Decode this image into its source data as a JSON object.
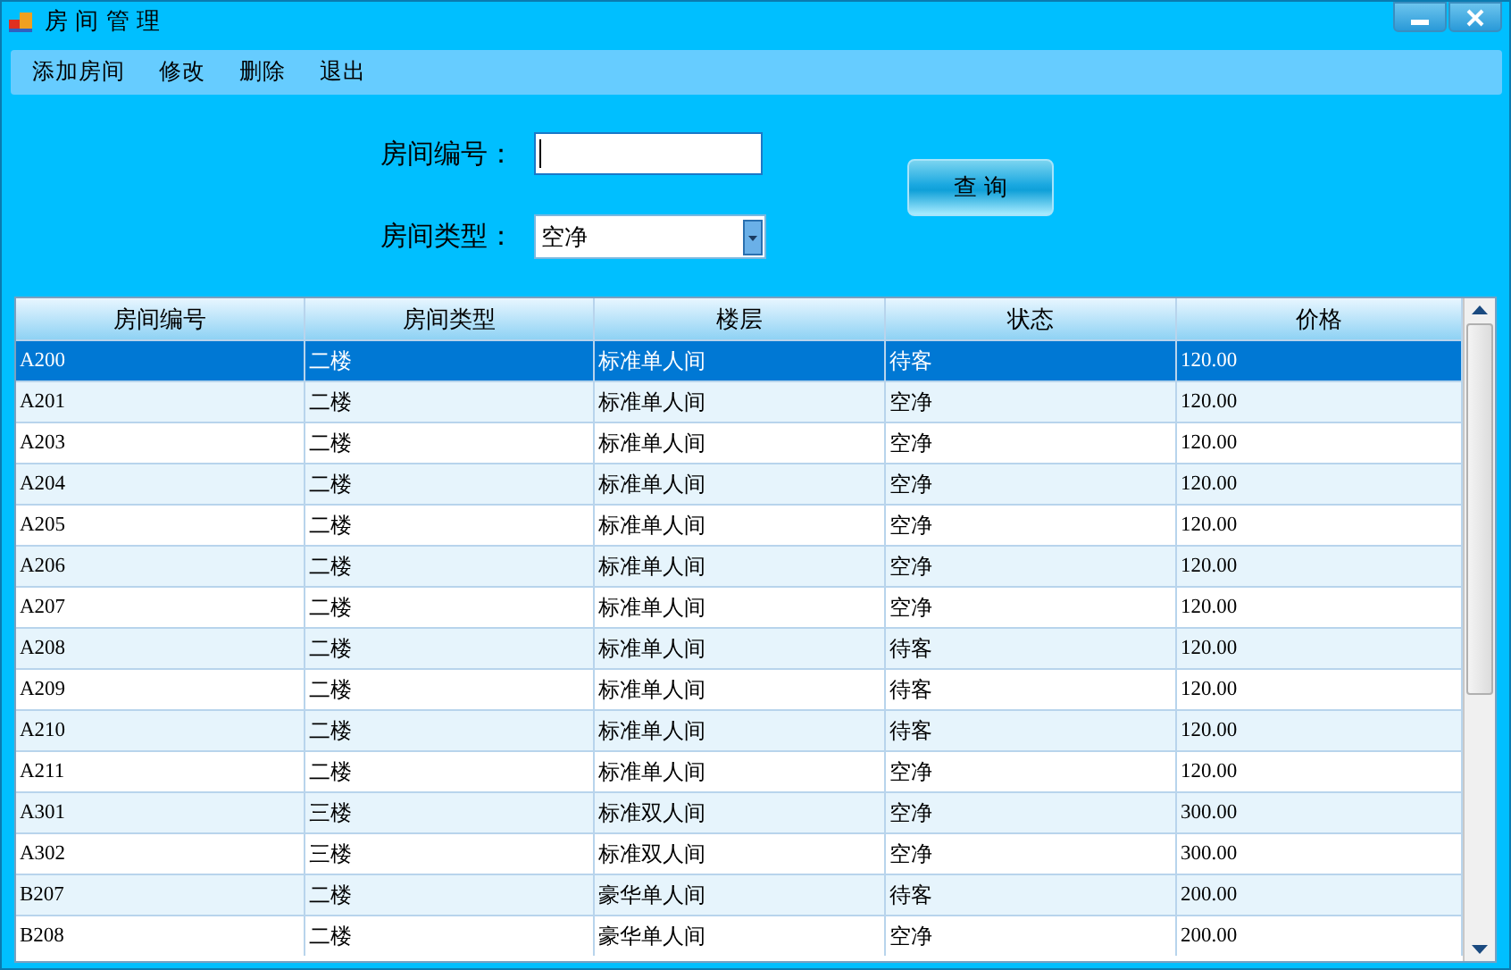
{
  "window": {
    "title": "房 间 管 理"
  },
  "menu": [
    "添加房间",
    "修改",
    "删除",
    "退出"
  ],
  "form": {
    "number_label": "房间编号：",
    "type_label": "房间类型：",
    "type_value": "空净",
    "query_button": "查 询"
  },
  "table": {
    "columns": [
      "房间编号",
      "房间类型",
      "楼层",
      "状态",
      "价格"
    ],
    "rows": [
      {
        "cells": [
          "A200",
          "二楼",
          "标准单人间",
          "待客",
          "120.00"
        ],
        "selected": true
      },
      {
        "cells": [
          "A201",
          "二楼",
          "标准单人间",
          "空净",
          "120.00"
        ],
        "selected": false
      },
      {
        "cells": [
          "A203",
          "二楼",
          "标准单人间",
          "空净",
          "120.00"
        ],
        "selected": false
      },
      {
        "cells": [
          "A204",
          "二楼",
          "标准单人间",
          "空净",
          "120.00"
        ],
        "selected": false
      },
      {
        "cells": [
          "A205",
          "二楼",
          "标准单人间",
          "空净",
          "120.00"
        ],
        "selected": false
      },
      {
        "cells": [
          "A206",
          "二楼",
          "标准单人间",
          "空净",
          "120.00"
        ],
        "selected": false
      },
      {
        "cells": [
          "A207",
          "二楼",
          "标准单人间",
          "空净",
          "120.00"
        ],
        "selected": false
      },
      {
        "cells": [
          "A208",
          "二楼",
          "标准单人间",
          "待客",
          "120.00"
        ],
        "selected": false
      },
      {
        "cells": [
          "A209",
          "二楼",
          "标准单人间",
          "待客",
          "120.00"
        ],
        "selected": false
      },
      {
        "cells": [
          "A210",
          "二楼",
          "标准单人间",
          "待客",
          "120.00"
        ],
        "selected": false
      },
      {
        "cells": [
          "A211",
          "二楼",
          "标准单人间",
          "空净",
          "120.00"
        ],
        "selected": false
      },
      {
        "cells": [
          "A301",
          "三楼",
          "标准双人间",
          "空净",
          "300.00"
        ],
        "selected": false
      },
      {
        "cells": [
          "A302",
          "三楼",
          "标准双人间",
          "空净",
          "300.00"
        ],
        "selected": false
      },
      {
        "cells": [
          "B207",
          "二楼",
          "豪华单人间",
          "待客",
          "200.00"
        ],
        "selected": false
      },
      {
        "cells": [
          "B208",
          "二楼",
          "豪华单人间",
          "空净",
          "200.00"
        ],
        "selected": false
      }
    ]
  }
}
